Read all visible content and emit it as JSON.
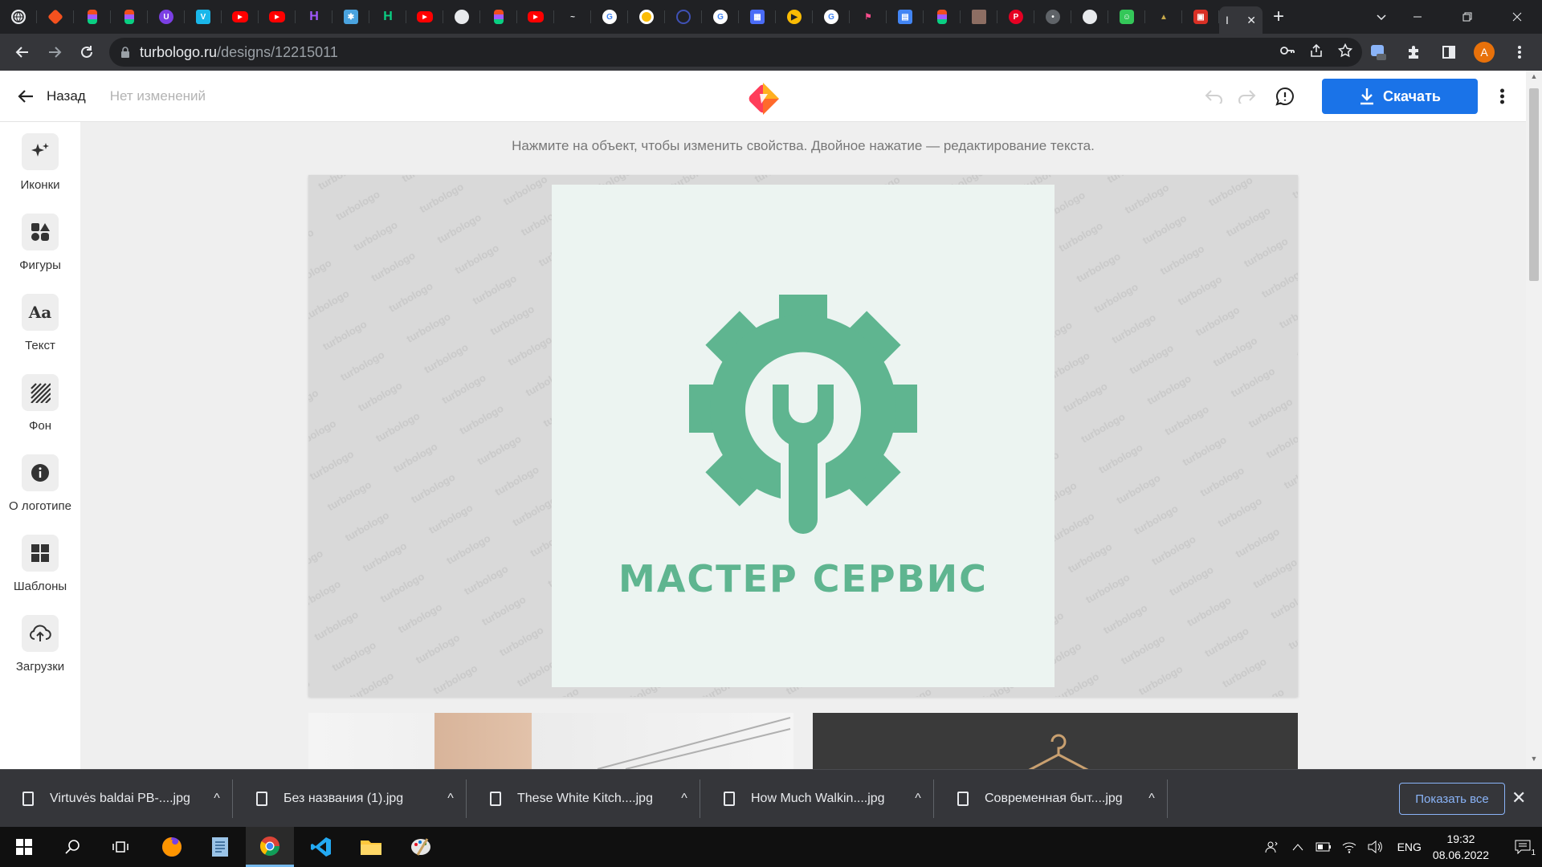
{
  "browser": {
    "active_tab_glyph": "I",
    "url_host": "turbologo.ru",
    "url_path": "/designs/12215011"
  },
  "header": {
    "back_label": "Назад",
    "status": "Нет изменений",
    "download_label": "Скачать"
  },
  "sidebar": {
    "items": [
      {
        "label": "Иконки",
        "icon": "sparkles-icon"
      },
      {
        "label": "Фигуры",
        "icon": "shapes-icon"
      },
      {
        "label": "Текст",
        "icon": "text-icon"
      },
      {
        "label": "Фон",
        "icon": "background-icon"
      },
      {
        "label": "О логотипе",
        "icon": "info-icon"
      },
      {
        "label": "Шаблоны",
        "icon": "templates-icon"
      },
      {
        "label": "Загрузки",
        "icon": "upload-icon"
      }
    ]
  },
  "editor": {
    "hint": "Нажмите на объект, чтобы изменить свойства. Двойное нажатие — редактирование текста.",
    "brand_name": "МАСТЕР СЕРВИС",
    "watermark": "turbologo",
    "accent_color": "#5fb590",
    "canvas_bg": "#ecf4f1"
  },
  "downloads": {
    "items": [
      {
        "name": "Virtuvės baldai PB-....jpg"
      },
      {
        "name": "Без названия (1).jpg"
      },
      {
        "name": "These White Kitch....jpg"
      },
      {
        "name": "How Much Walkin....jpg"
      },
      {
        "name": "Современная быт....jpg"
      }
    ],
    "show_all": "Показать все"
  },
  "taskbar": {
    "lang": "ENG",
    "time": "19:32",
    "date": "08.06.2022",
    "notifications": "1"
  },
  "colors": {
    "primary_button": "#1a73e8",
    "chrome_dark": "#202124"
  }
}
